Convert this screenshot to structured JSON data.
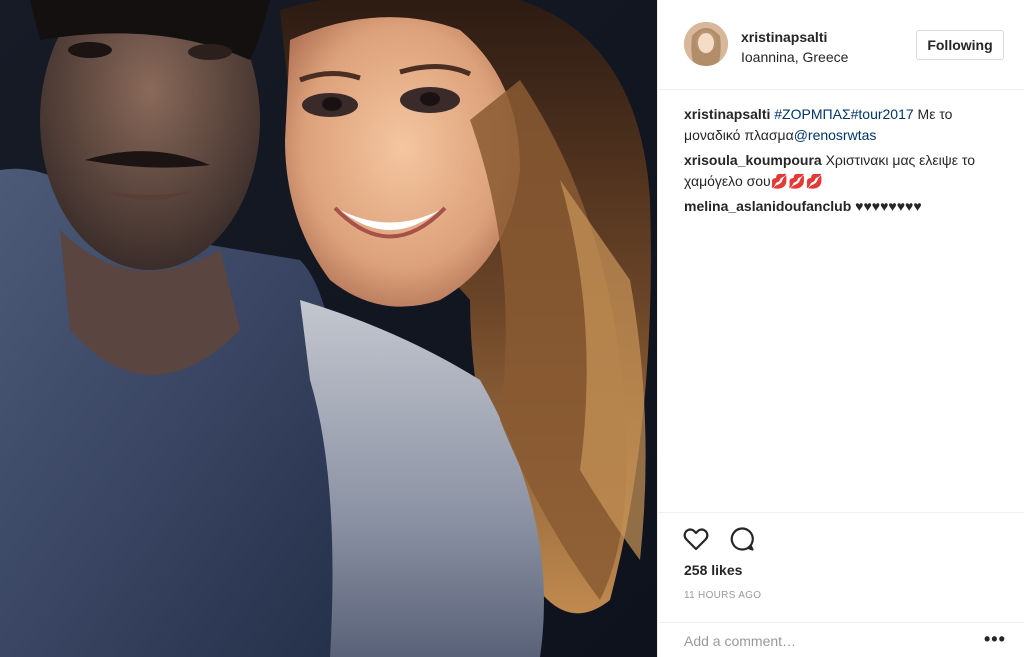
{
  "post": {
    "photo": {
      "description_icon": "selfie-photo"
    },
    "header": {
      "username": "xristinapsalti",
      "location": "Ioannina, Greece",
      "follow_label": "Following"
    },
    "caption": {
      "user": "xristinapsalti",
      "hashtag1": "#ΖΟΡΜΠΑΣ",
      "hashtag2": "#tour2017",
      "text": " Με το μοναδικό πλασμα",
      "mention": "@renosrwtas"
    },
    "comments": [
      {
        "user": "xrisoula_koumpoura",
        "text": "Χριστινακι μας ελειψε το χαμόγελο σου💋💋💋"
      },
      {
        "user": "melina_aslanidoufanclub",
        "text": "♥♥♥♥♥♥♥♥"
      }
    ],
    "actions": {
      "like_icon": "heart-icon",
      "comment_icon": "comment-icon"
    },
    "likes": "258 likes",
    "timestamp": "11 HOURS AGO",
    "add_comment_placeholder": "Add a comment…",
    "more_label": "•••",
    "colors": {
      "link": "#003569",
      "border": "#efefef",
      "muted": "#999999"
    }
  }
}
